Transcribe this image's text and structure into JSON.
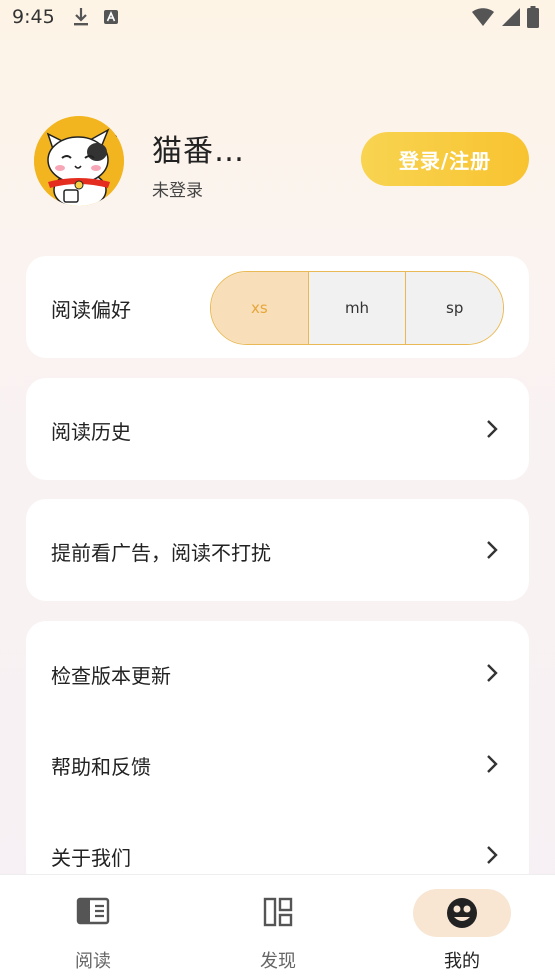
{
  "status_bar": {
    "time": "9:45",
    "left_icons": [
      "download-icon",
      "a-badge-icon"
    ],
    "right_icons": [
      "wifi-icon",
      "signal-icon",
      "battery-icon"
    ]
  },
  "profile": {
    "username": "猫番…",
    "login_status": "未登录",
    "login_button": "登录/注册",
    "avatar": "lucky-cat-avatar"
  },
  "preferences": {
    "label": "阅读偏好",
    "options": [
      "xs",
      "mh",
      "sp"
    ],
    "selected": "xs"
  },
  "menu": {
    "history": "阅读历史",
    "ad_free": "提前看广告，阅读不打扰",
    "check_update": "检查版本更新",
    "help_feedback": "帮助和反馈",
    "about_us": "关于我们"
  },
  "bottom_nav": {
    "items": [
      {
        "label": "阅读",
        "icon": "book-icon"
      },
      {
        "label": "发现",
        "icon": "discover-grid-icon"
      },
      {
        "label": "我的",
        "icon": "profile-face-icon"
      }
    ],
    "active": "我的"
  },
  "colors": {
    "accent": "#f8c330",
    "segment_active_bg": "#f8dfba",
    "segment_active_text": "#e7a639",
    "nav_active_pill": "#f8e6d3"
  }
}
